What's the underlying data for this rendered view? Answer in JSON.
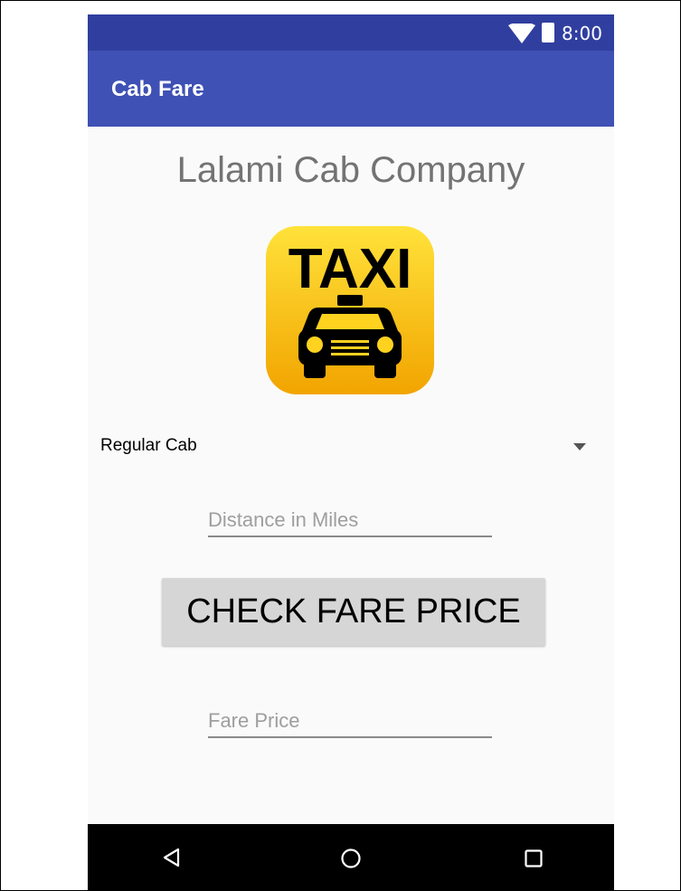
{
  "status_bar": {
    "time": "8:00",
    "icons": [
      "wifi-icon",
      "battery-icon"
    ]
  },
  "app_bar": {
    "title": "Cab Fare"
  },
  "main": {
    "heading": "Lalami Cab Company",
    "logo": {
      "icon": "taxi-logo-icon",
      "text": "TAXI",
      "colors": {
        "top": "#ffe23a",
        "bottom": "#f2a400",
        "ink": "#000000"
      }
    },
    "cab_type": {
      "selected": "Regular Cab"
    },
    "distance_field": {
      "placeholder": "Distance in Miles",
      "value": ""
    },
    "check_button": {
      "label": "CHECK FARE PRICE"
    },
    "fare_field": {
      "placeholder": "Fare Price",
      "value": ""
    }
  },
  "nav_bar": {
    "buttons": [
      "back-icon",
      "home-icon",
      "recent-apps-icon"
    ]
  },
  "colors": {
    "status_bar": "#303f9f",
    "app_bar": "#3f51b5",
    "background": "#fafafa",
    "button": "#d6d6d6",
    "nav_bar": "#000000"
  }
}
